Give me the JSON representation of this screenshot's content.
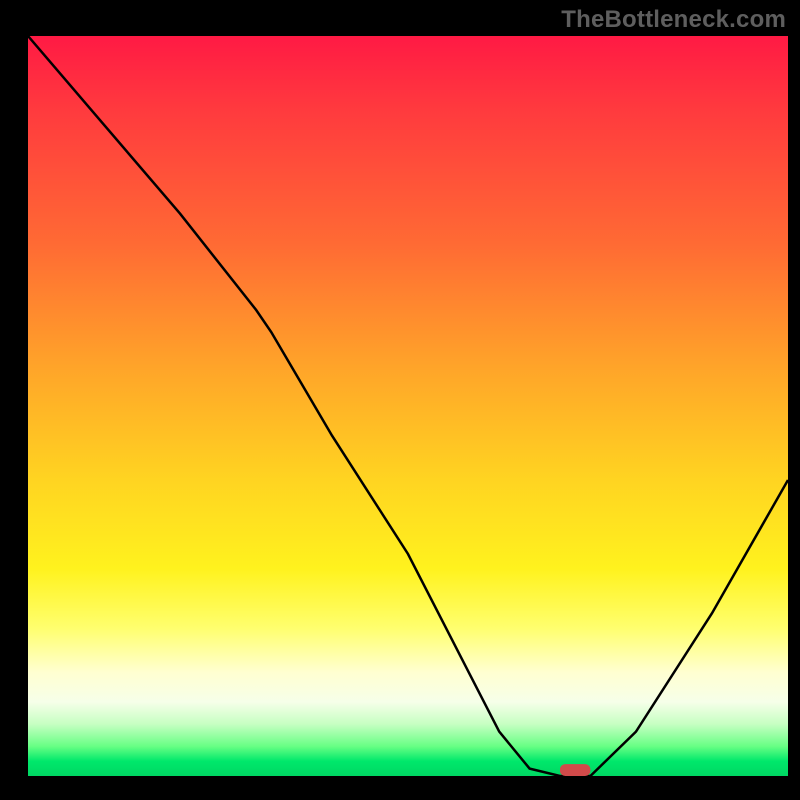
{
  "watermark": "TheBottleneck.com",
  "chart_data": {
    "type": "line",
    "title": "",
    "xlabel": "",
    "ylabel": "",
    "xlim": [
      0,
      100
    ],
    "ylim": [
      0,
      100
    ],
    "grid": false,
    "legend": null,
    "series": [
      {
        "name": "bottleneck-curve",
        "x": [
          0,
          10,
          20,
          30,
          32,
          40,
          50,
          58,
          62,
          66,
          70,
          74,
          80,
          90,
          100
        ],
        "values": [
          100,
          88,
          76,
          63,
          60,
          46,
          30,
          14,
          6,
          1,
          0,
          0,
          6,
          22,
          40
        ]
      }
    ],
    "marker": {
      "name": "optimal-point",
      "x": 72,
      "y": 0,
      "color": "#d14a4a"
    },
    "gradient_stops": [
      {
        "pos": 0.0,
        "color": "#ff1a44"
      },
      {
        "pos": 0.45,
        "color": "#ffa529"
      },
      {
        "pos": 0.72,
        "color": "#fff21e"
      },
      {
        "pos": 0.9,
        "color": "#f6ffe9"
      },
      {
        "pos": 1.0,
        "color": "#00d763"
      }
    ]
  }
}
